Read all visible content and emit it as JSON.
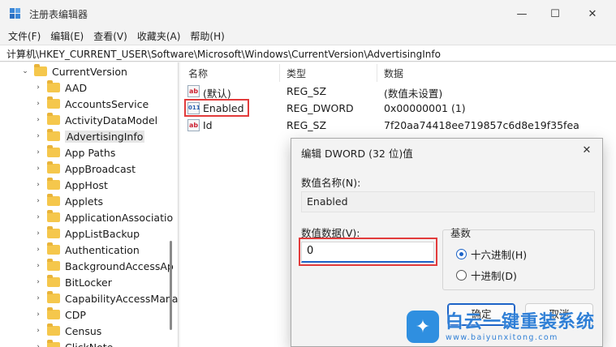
{
  "window": {
    "title": "注册表编辑器",
    "minimize": "—",
    "maximize": "☐",
    "close": "✕"
  },
  "menu": [
    "文件(F)",
    "编辑(E)",
    "查看(V)",
    "收藏夹(A)",
    "帮助(H)"
  ],
  "address": "计算机\\HKEY_CURRENT_USER\\Software\\Microsoft\\Windows\\CurrentVersion\\AdvertisingInfo",
  "tree": {
    "parent": "CurrentVersion",
    "items": [
      "AAD",
      "AccountsService",
      "ActivityDataModel",
      "AdvertisingInfo",
      "App Paths",
      "AppBroadcast",
      "AppHost",
      "Applets",
      "ApplicationAssociatio",
      "AppListBackup",
      "Authentication",
      "BackgroundAccessAp",
      "BitLocker",
      "CapabilityAccessMana",
      "CDP",
      "Census",
      "ClickNote"
    ],
    "selected": "AdvertisingInfo"
  },
  "columns": {
    "name": "名称",
    "type": "类型",
    "data": "数据"
  },
  "values": [
    {
      "icon": "string-value-icon",
      "glyph": "ab",
      "name": "(默认)",
      "type": "REG_SZ",
      "data": "(数值未设置)"
    },
    {
      "icon": "dword-value-icon",
      "glyph": "011",
      "name": "Enabled",
      "type": "REG_DWORD",
      "data": "0x00000001 (1)"
    },
    {
      "icon": "string-value-icon",
      "glyph": "ab",
      "name": "Id",
      "type": "REG_SZ",
      "data": "7f20aa74418ee719857c6d8e19f35fea"
    }
  ],
  "dialog": {
    "title": "编辑 DWORD (32 位)值",
    "close": "✕",
    "name_label": "数值名称(N):",
    "name_value": "Enabled",
    "data_label": "数值数据(V):",
    "data_value": "0",
    "base_label": "基数",
    "radio_hex": "十六进制(H)",
    "radio_dec": "十进制(D)",
    "ok": "确定",
    "cancel": "取消"
  },
  "watermark": {
    "text": "白云一键重装系统",
    "url": "www.baiyunxitong.com"
  }
}
